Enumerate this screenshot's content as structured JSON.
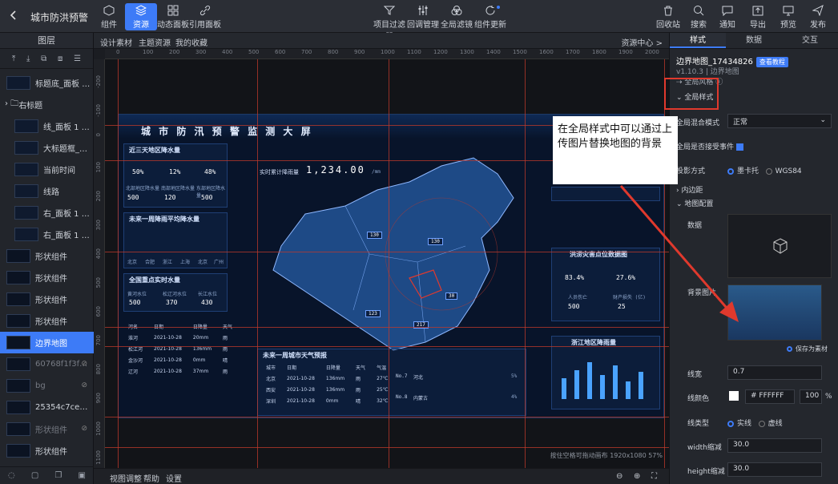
{
  "app": {
    "title": "城市防洪预警"
  },
  "toolbar": {
    "left": [
      {
        "label": "组件",
        "icon": "component-icon"
      },
      {
        "label": "资源",
        "icon": "layers-icon"
      },
      {
        "label": "动态面板",
        "icon": "grid-icon"
      },
      {
        "label": "引用面板",
        "icon": "link-icon"
      }
    ],
    "middle": [
      {
        "label": "项目过滤器",
        "icon": "filter-icon"
      },
      {
        "label": "回调管理",
        "icon": "sliders-icon"
      },
      {
        "label": "全局滤镜",
        "icon": "circles-icon"
      },
      {
        "label": "组件更新",
        "icon": "refresh-icon"
      }
    ],
    "right": [
      {
        "label": "回收站",
        "icon": "trash-icon"
      },
      {
        "label": "搜索",
        "icon": "search-icon"
      },
      {
        "label": "通知",
        "icon": "message-icon"
      },
      {
        "label": "导出",
        "icon": "export-icon"
      },
      {
        "label": "预览",
        "icon": "preview-icon"
      },
      {
        "label": "发布",
        "icon": "send-icon"
      }
    ]
  },
  "left_panel": {
    "title": "图层",
    "layers": [
      {
        "label": "标题底_面板 1 ...",
        "type": "item"
      },
      {
        "label": "右标题",
        "type": "folder"
      },
      {
        "label": "线_面板 1 副本",
        "type": "item"
      },
      {
        "label": "大标题框_面板 ...",
        "type": "item"
      },
      {
        "label": "当前时间",
        "type": "item"
      },
      {
        "label": "线路",
        "type": "item"
      },
      {
        "label": "右_面板 1 副本",
        "type": "item"
      },
      {
        "label": "右_面板 1 副本",
        "type": "item"
      },
      {
        "label": "形状组件",
        "type": "item"
      },
      {
        "label": "形状组件",
        "type": "item"
      },
      {
        "label": "形状组件",
        "type": "item"
      },
      {
        "label": "形状组件",
        "type": "item"
      },
      {
        "label": "边界地图",
        "type": "item",
        "selected": true
      },
      {
        "label": "60768f1f3fc22...",
        "type": "item",
        "dim": true
      },
      {
        "label": "bg",
        "type": "item",
        "dim": true
      },
      {
        "label": "25354c7ce6cfefd...",
        "type": "item"
      },
      {
        "label": "形状组件",
        "type": "item",
        "dim": true
      },
      {
        "label": "形状组件",
        "type": "item"
      }
    ]
  },
  "center_tabs": {
    "tabs": [
      "设计素材",
      "主题资源",
      "我的收藏"
    ],
    "right": "资源中心 >"
  },
  "ruler": {
    "top": [
      "0",
      "100",
      "200",
      "300",
      "400",
      "500",
      "600",
      "700",
      "800",
      "900",
      "1000",
      "1100",
      "1200",
      "1300",
      "1400",
      "1500",
      "1600",
      "1700",
      "1800",
      "1900",
      "2000"
    ],
    "left": [
      "-200",
      "-100",
      "0",
      "100",
      "200",
      "300",
      "400",
      "500",
      "600",
      "700",
      "800",
      "900",
      "1000",
      "1100"
    ]
  },
  "screen": {
    "title": "城 市 防 汛 预 警 监 测 大 屏",
    "p1": {
      "head": "近三天地区降水量",
      "pcts": [
        "50%",
        "12%",
        "48%"
      ],
      "vals": [
        "500",
        "120",
        "500"
      ],
      "labels": [
        "北部地区降水量",
        "南部地区降水量",
        "东部地区降水量"
      ],
      "unit": "mm"
    },
    "p2": {
      "head": "未来一周降雨平均降水量",
      "cities": [
        "北京",
        "合肥",
        "浙江",
        "上海",
        "北京",
        "广州"
      ]
    },
    "p3": {
      "head": "全国重点实时水量",
      "items": [
        {
          "name": "黄河水位",
          "v": "500"
        },
        {
          "name": "松辽河水位",
          "v": "370"
        },
        {
          "name": "长江水位",
          "v": "430"
        }
      ]
    },
    "table1": {
      "head": [
        "河名",
        "日期",
        "日降量",
        "天气"
      ],
      "rows": [
        [
          "淮河",
          "2021-10-28",
          "20mm",
          "雨"
        ],
        [
          "松江河",
          "2021-10-28",
          "136mm",
          "雨"
        ],
        [
          "金沙河",
          "2021-10-28",
          "0mm",
          "晴"
        ],
        [
          "辽河",
          "2021-10-28",
          "37mm",
          "雨"
        ]
      ]
    },
    "rain_label": "实时累计降雨量",
    "rain_value": "1,234.00",
    "rain_unit": "/mm",
    "callouts": [
      "130",
      "30",
      "123",
      "217",
      "130"
    ],
    "p4": {
      "head": "洪涝灾害点位数据图",
      "pct1": "83.4%",
      "pct2": "27.6%",
      "l1": "人员伤亡",
      "v1": "500",
      "l2": "财产损失 (亿)",
      "v2": "25"
    },
    "p5": {
      "head": "浙江地区降雨量"
    },
    "p6": {
      "head": "未来一周城市天气预报",
      "table": {
        "head": [
          "城市",
          "日期",
          "日降量",
          "天气",
          "气温"
        ],
        "rows": [
          [
            "北京",
            "2021-10-28",
            "136mm",
            "雨",
            "27℃"
          ],
          [
            "西安",
            "2021-10-28",
            "136mm",
            "雨",
            "25℃"
          ],
          [
            "深圳",
            "2021-10-28",
            "0mm",
            "晴",
            "32℃"
          ]
        ]
      },
      "rank": [
        {
          "n": "No.7",
          "c": "河北",
          "p": "5%"
        },
        {
          "n": "No.8",
          "c": "内蒙古",
          "p": "4%"
        }
      ]
    }
  },
  "bottom": {
    "items": [
      "视图调整",
      "帮助",
      "设置"
    ],
    "status": "按住空格可拖动画布   1920x1080 57%"
  },
  "right_panel": {
    "tabs": [
      "样式",
      "数据",
      "交互"
    ],
    "component_name": "边界地图_17434826",
    "doc_btn": "查看教程",
    "version": "v1.10.3 | 边界地图",
    "global_style_link": "全局风格",
    "section_global": "全局样式",
    "blend_label": "全局混合模式",
    "blend_value": "正常",
    "event_label": "全局是否接受事件",
    "proj_label": "投影方式",
    "proj_opt1": "墨卡托",
    "proj_opt2": "WGS84",
    "padding_label": "内边距",
    "map_cfg": "地图配置",
    "data_label": "数据",
    "bg_label": "背景图片",
    "save_label": "保存为素材",
    "line_w_label": "线宽",
    "line_w": "0.7",
    "line_c_label": "线颜色",
    "line_c": "# FFFFFF",
    "line_alpha": "100",
    "pct": "%",
    "line_t_label": "线类型",
    "lt1": "实线",
    "lt2": "虚线",
    "wz_label": "width缩减",
    "wz": "30.0",
    "hz_label": "height缩减",
    "hz": "30.0"
  },
  "annotation": {
    "text": "在全局样式中可以通过上传图片替换地图的背景"
  },
  "colors": {
    "accent": "#3d7bf7",
    "highlight": "#e0392d"
  }
}
